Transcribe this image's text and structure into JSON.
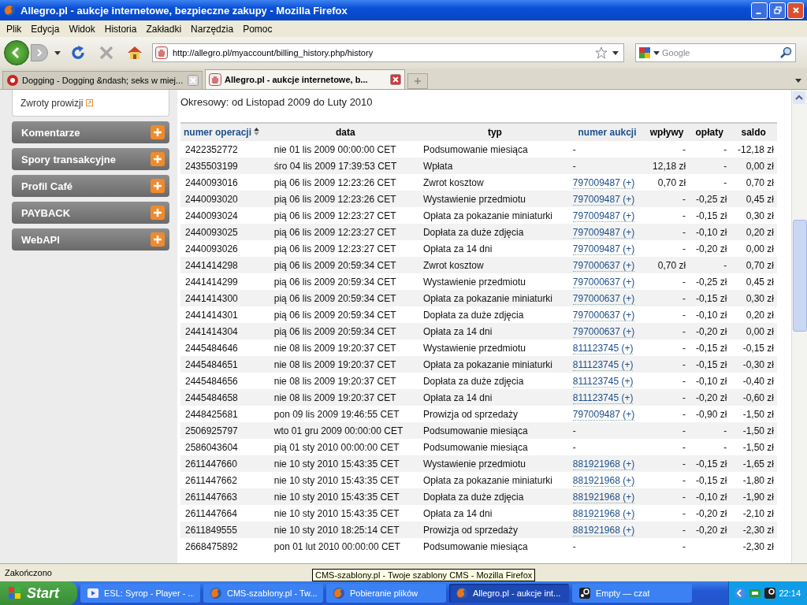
{
  "window": {
    "title": "Allegro.pl - aukcje internetowe, bezpieczne zakupy - Mozilla Firefox"
  },
  "menu": [
    "Plik",
    "Edycja",
    "Widok",
    "Historia",
    "Zakładki",
    "Narzędzia",
    "Pomoc"
  ],
  "toolbar": {
    "url": "http://allegro.pl/myaccount/billing_history.php/history",
    "search_placeholder": "Google"
  },
  "tabs": [
    {
      "label": "Dogging - Dogging &ndash; seks w miej...",
      "selected": false
    },
    {
      "label": "Allegro.pl - aukcje internetowe, b...",
      "selected": true
    }
  ],
  "sidebar": {
    "link": "Zwroty prowizji",
    "sections": [
      "Komentarze",
      "Spory transakcyjne",
      "Profil Café",
      "PAYBACK",
      "WebAPI"
    ]
  },
  "period": "Okresowy: od Listopad 2009 do Luty 2010",
  "table": {
    "columns": [
      {
        "label": "numer operacji",
        "kind": "sort"
      },
      {
        "label": "data",
        "kind": "plain"
      },
      {
        "label": "typ",
        "kind": "plain"
      },
      {
        "label": "numer aukcji",
        "kind": "link"
      },
      {
        "label": "wpływy",
        "kind": "plain"
      },
      {
        "label": "opłaty",
        "kind": "plain"
      },
      {
        "label": "saldo",
        "kind": "plain"
      }
    ],
    "rows": [
      [
        "2422352772",
        "nie 01 lis 2009 00:00:00 CET",
        "Podsumowanie miesiąca",
        "-",
        "-",
        "-",
        "-12,18 zł"
      ],
      [
        "2435503199",
        "śro 04 lis 2009 17:39:53 CET",
        "Wpłata",
        "-",
        "12,18 zł",
        "-",
        "0,00 zł"
      ],
      [
        "2440093016",
        "pią 06 lis 2009 12:23:26 CET",
        "Zwrot kosztow",
        "797009487 (+)",
        "0,70 zł",
        "-",
        "0,70 zł"
      ],
      [
        "2440093020",
        "pią 06 lis 2009 12:23:26 CET",
        "Wystawienie przedmiotu",
        "797009487 (+)",
        "-",
        "-0,25 zł",
        "0,45 zł"
      ],
      [
        "2440093024",
        "pią 06 lis 2009 12:23:27 CET",
        "Opłata za pokazanie miniaturki",
        "797009487 (+)",
        "-",
        "-0,15 zł",
        "0,30 zł"
      ],
      [
        "2440093025",
        "pią 06 lis 2009 12:23:27 CET",
        "Dopłata za duże zdjęcia",
        "797009487 (+)",
        "-",
        "-0,10 zł",
        "0,20 zł"
      ],
      [
        "2440093026",
        "pią 06 lis 2009 12:23:27 CET",
        "Opłata za 14 dni",
        "797009487 (+)",
        "-",
        "-0,20 zł",
        "0,00 zł"
      ],
      [
        "2441414298",
        "pią 06 lis 2009 20:59:34 CET",
        "Zwrot kosztow",
        "797000637 (+)",
        "0,70 zł",
        "-",
        "0,70 zł"
      ],
      [
        "2441414299",
        "pią 06 lis 2009 20:59:34 CET",
        "Wystawienie przedmiotu",
        "797000637 (+)",
        "-",
        "-0,25 zł",
        "0,45 zł"
      ],
      [
        "2441414300",
        "pią 06 lis 2009 20:59:34 CET",
        "Opłata za pokazanie miniaturki",
        "797000637 (+)",
        "-",
        "-0,15 zł",
        "0,30 zł"
      ],
      [
        "2441414301",
        "pią 06 lis 2009 20:59:34 CET",
        "Dopłata za duże zdjęcia",
        "797000637 (+)",
        "-",
        "-0,10 zł",
        "0,20 zł"
      ],
      [
        "2441414304",
        "pią 06 lis 2009 20:59:34 CET",
        "Opłata za 14 dni",
        "797000637 (+)",
        "-",
        "-0,20 zł",
        "0,00 zł"
      ],
      [
        "2445484646",
        "nie 08 lis 2009 19:20:37 CET",
        "Wystawienie przedmiotu",
        "811123745 (+)",
        "-",
        "-0,15 zł",
        "-0,15 zł"
      ],
      [
        "2445484651",
        "nie 08 lis 2009 19:20:37 CET",
        "Opłata za pokazanie miniaturki",
        "811123745 (+)",
        "-",
        "-0,15 zł",
        "-0,30 zł"
      ],
      [
        "2445484656",
        "nie 08 lis 2009 19:20:37 CET",
        "Dopłata za duże zdjęcia",
        "811123745 (+)",
        "-",
        "-0,10 zł",
        "-0,40 zł"
      ],
      [
        "2445484658",
        "nie 08 lis 2009 19:20:37 CET",
        "Opłata za 14 dni",
        "811123745 (+)",
        "-",
        "-0,20 zł",
        "-0,60 zł"
      ],
      [
        "2448425681",
        "pon 09 lis 2009 19:46:55 CET",
        "Prowizja od sprzedaży",
        "797009487 (+)",
        "-",
        "-0,90 zł",
        "-1,50 zł"
      ],
      [
        "2506925797",
        "wto 01 gru 2009 00:00:00 CET",
        "Podsumowanie miesiąca",
        "-",
        "-",
        "-",
        "-1,50 zł"
      ],
      [
        "2586043604",
        "pią 01 sty 2010 00:00:00 CET",
        "Podsumowanie miesiąca",
        "-",
        "-",
        "-",
        "-1,50 zł"
      ],
      [
        "2611447660",
        "nie 10 sty 2010 15:43:35 CET",
        "Wystawienie przedmiotu",
        "881921968 (+)",
        "-",
        "-0,15 zł",
        "-1,65 zł"
      ],
      [
        "2611447662",
        "nie 10 sty 2010 15:43:35 CET",
        "Opłata za pokazanie miniaturki",
        "881921968 (+)",
        "-",
        "-0,15 zł",
        "-1,80 zł"
      ],
      [
        "2611447663",
        "nie 10 sty 2010 15:43:35 CET",
        "Dopłata za duże zdjęcia",
        "881921968 (+)",
        "-",
        "-0,10 zł",
        "-1,90 zł"
      ],
      [
        "2611447664",
        "nie 10 sty 2010 15:43:35 CET",
        "Opłata za 14 dni",
        "881921968 (+)",
        "-",
        "-0,20 zł",
        "-2,10 zł"
      ],
      [
        "2611849555",
        "nie 10 sty 2010 18:25:14 CET",
        "Prowizja od sprzedaży",
        "881921968 (+)",
        "-",
        "-0,20 zł",
        "-2,30 zł"
      ],
      [
        "2668475892",
        "pon 01 lut 2010 00:00:00 CET",
        "Podsumowanie miesiąca",
        "-",
        "-",
        "",
        "-2,30 zł"
      ]
    ]
  },
  "status_bar": {
    "text": "Zakończono",
    "tooltip": "CMS-szablony.pl - Twoje szablony CMS - Mozilla Firefox"
  },
  "taskbar": {
    "start": "Start",
    "items": [
      {
        "label": "ESL: Syrop - Player - ...",
        "kind": "player",
        "selected": false
      },
      {
        "label": "CMS-szablony.pl - Tw...",
        "kind": "firefox",
        "selected": false
      },
      {
        "label": "Pobieranie plików",
        "kind": "firefox",
        "selected": false
      },
      {
        "label": "Allegro.pl - aukcje int...",
        "kind": "firefox",
        "selected": true
      },
      {
        "label": "Empty — czat",
        "kind": "steam",
        "selected": false
      }
    ],
    "clock": "22:14"
  }
}
